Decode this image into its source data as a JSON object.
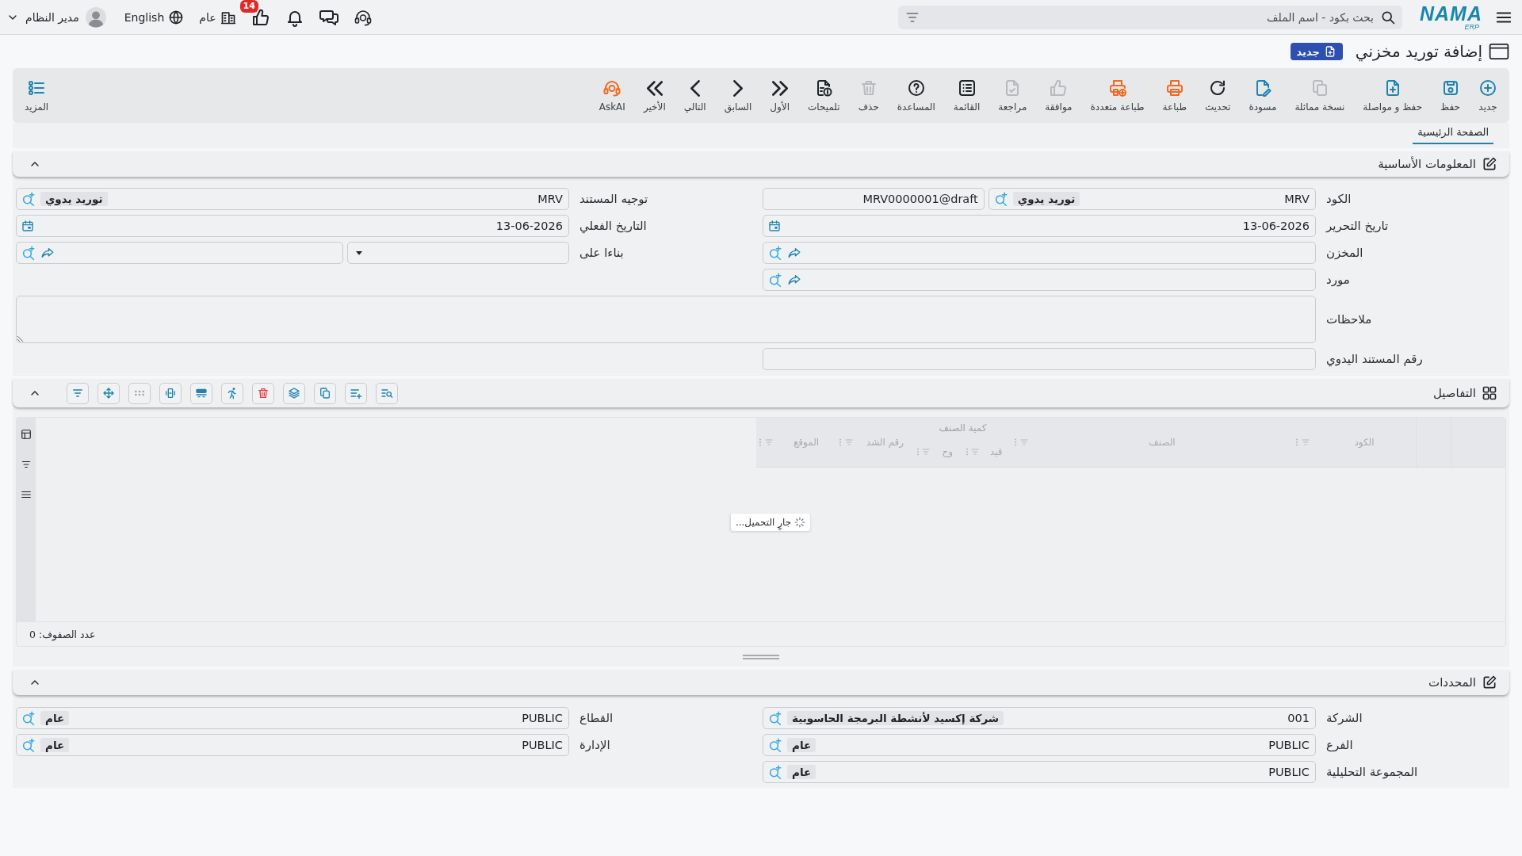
{
  "topbar": {
    "logo": {
      "name": "NAMA",
      "sub": "ERP"
    },
    "search": {
      "placeholder": "بحث بكود - اسم الملف"
    },
    "likes_badge": "14",
    "branch": "عام",
    "language": "English",
    "user": {
      "name": "مدير النظام"
    }
  },
  "page": {
    "title": "إضافة توريد مخزني",
    "status_badge": "جديد"
  },
  "toolbar": {
    "buttons": [
      {
        "kind": "add",
        "label": "جديد",
        "disabled": false
      },
      {
        "kind": "save",
        "label": "حفظ",
        "disabled": false
      },
      {
        "kind": "savenext",
        "label": "حفظ و مواصلة",
        "disabled": false
      },
      {
        "kind": "duplicate",
        "label": "نسخة مماثلة",
        "disabled": true
      },
      {
        "kind": "draft",
        "label": "مسودة",
        "disabled": false
      },
      {
        "kind": "refresh",
        "label": "تحديث",
        "disabled": false
      },
      {
        "kind": "print",
        "label": "طباعة",
        "disabled": false
      },
      {
        "kind": "multiprint",
        "label": "طباعة متعددة",
        "disabled": false
      },
      {
        "kind": "approve",
        "label": "موافقة",
        "disabled": true
      },
      {
        "kind": "review",
        "label": "مراجعة",
        "disabled": true
      },
      {
        "kind": "list",
        "label": "القائمة",
        "disabled": false
      },
      {
        "kind": "help",
        "label": "المساعدة",
        "disabled": false
      },
      {
        "kind": "delete",
        "label": "حذف",
        "disabled": true
      },
      {
        "kind": "hints",
        "label": "تلميحات",
        "disabled": false
      },
      {
        "kind": "first",
        "label": "الأول",
        "disabled": false
      },
      {
        "kind": "previous",
        "label": "السابق",
        "disabled": false
      },
      {
        "kind": "next",
        "label": "التالي",
        "disabled": false
      },
      {
        "kind": "last",
        "label": "الأخير",
        "disabled": false
      },
      {
        "kind": "askai",
        "label": "AskAI",
        "disabled": false
      }
    ],
    "more": {
      "label": "المزيد"
    }
  },
  "tabs": [
    {
      "label": "الصفحة الرئيسية",
      "selected": true
    }
  ],
  "basic_info": {
    "title": "المعلومات الأساسية",
    "expanded": true,
    "fields": [
      {
        "label": "الكود",
        "kind": "lookup",
        "value": "MRV",
        "chip": "توريد يدوي",
        "extra_value": "MRV0000001@draft"
      },
      {
        "label": "توجيه المستند",
        "kind": "lookup",
        "value": "MRV",
        "chip": "توريد يدوي"
      },
      {
        "label": "تاريخ التحرير",
        "kind": "date",
        "value": "13-06-2026"
      },
      {
        "label": "التاريخ الفعلي",
        "kind": "date",
        "value": "13-06-2026"
      },
      {
        "label": "المخزن",
        "kind": "picker"
      },
      {
        "label": "بناءا على",
        "kind": "selectpicker"
      },
      {
        "label": "مورد",
        "kind": "picker"
      },
      {
        "label": "ملاحظات",
        "kind": "textarea"
      },
      {
        "label": "رقم المستند اليدوي",
        "kind": "text"
      }
    ]
  },
  "details": {
    "title": "التفاصيل",
    "expanded": true,
    "grid": {
      "columns": [
        {
          "label": "الكود"
        },
        {
          "label": "الصنف"
        },
        {
          "label": "كمية الصنف",
          "children": [
            {
              "label": "قيد"
            },
            {
              "label": "وح"
            }
          ]
        },
        {
          "label": "رقم الشد"
        },
        {
          "label": "الموقع"
        }
      ],
      "loading_text": "جارٍ التحميل...",
      "row_count": "عدد الصفوف: 0"
    }
  },
  "selectors": {
    "title": "المحددات",
    "expanded": true,
    "fields": [
      {
        "label": "الشركة",
        "kind": "lookup",
        "value": "001",
        "chip": "شركة إكسيد لأنشطة البرمجة الحاسوبية"
      },
      {
        "label": "القطاع",
        "kind": "lookup",
        "value": "PUBLIC",
        "chip": "عام"
      },
      {
        "label": "الفرع",
        "kind": "lookup",
        "value": "PUBLIC",
        "chip": "عام"
      },
      {
        "label": "الإدارة",
        "kind": "lookup",
        "value": "PUBLIC",
        "chip": "عام"
      },
      {
        "label": "المجموعة التحليلية",
        "kind": "lookup",
        "value": "PUBLIC",
        "chip": "عام"
      }
    ]
  }
}
